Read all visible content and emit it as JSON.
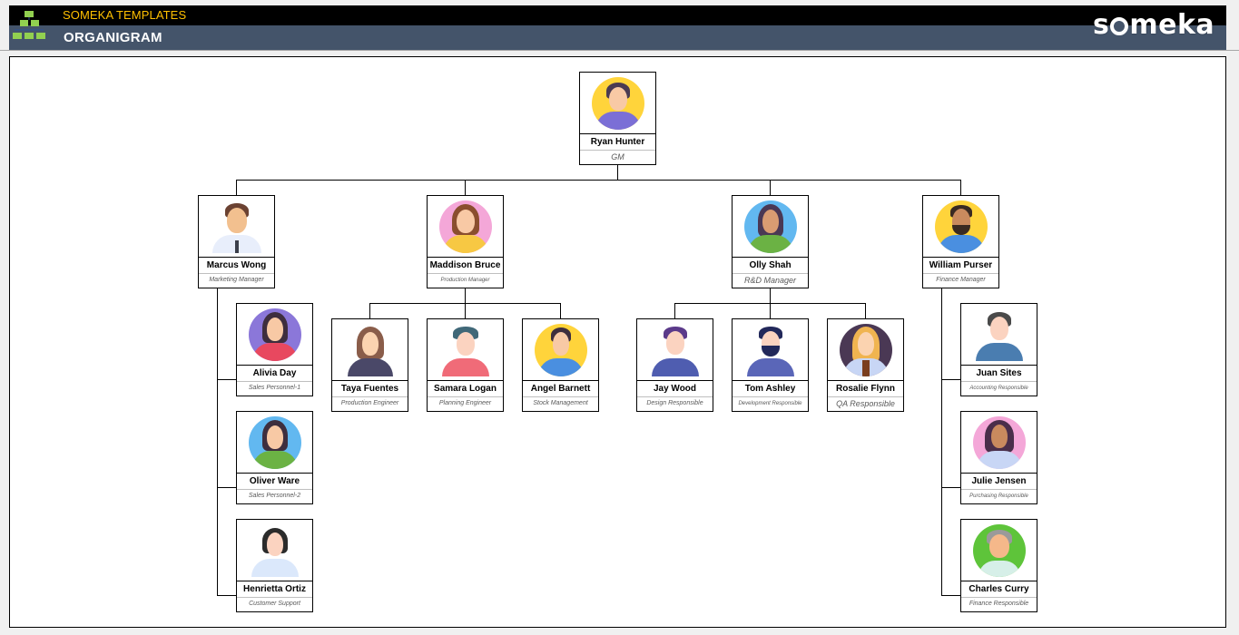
{
  "header": {
    "brand_top": "SOMEKA TEMPLATES",
    "title": "ORGANIGRAM",
    "logo_text": "someka",
    "colors": {
      "top_band": "#000000",
      "bottom_band": "#44546a",
      "brand_accent": "#ffc000"
    }
  },
  "org": {
    "root": {
      "name": "Ryan Hunter",
      "title": "GM",
      "avatar": "man-purple-shirt-yellow-bg"
    },
    "managers": [
      {
        "name": "Marcus Wong",
        "title": "Marketing Manager",
        "avatar": "man-tie-plain",
        "reports": [
          {
            "name": "Alivia Day",
            "title": "Sales Personnel-1",
            "avatar": "woman-red-hoodie-purple-bg"
          },
          {
            "name": "Oliver Ware",
            "title": "Sales Personnel-2",
            "avatar": "woman-green-sweater-blue-bg"
          },
          {
            "name": "Henrietta Ortiz",
            "title": "Customer Support",
            "avatar": "woman-nurse-plain"
          }
        ]
      },
      {
        "name": "Maddison Bruce",
        "title": "Production Manager",
        "avatar": "woman-yellow-jacket-pink-bg",
        "reports": [
          {
            "name": "Taya Fuentes",
            "title": "Production Engineer",
            "avatar": "woman-dark-blazer-plain"
          },
          {
            "name": "Samara Logan",
            "title": "Planning Engineer",
            "avatar": "man-red-shirt-plain"
          },
          {
            "name": "Angel Barnett",
            "title": "Stock Management",
            "avatar": "woman-ponytail-yellow-bg"
          }
        ]
      },
      {
        "name": "Olly Shah",
        "title": "R&D Manager",
        "avatar": "woman-green-hoodie-blue-bg",
        "reports": [
          {
            "name": "Jay Wood",
            "title": "Design Responsible",
            "avatar": "man-purple-hair-plain"
          },
          {
            "name": "Tom Ashley",
            "title": "Development Responsible",
            "avatar": "man-beard-glasses-plain"
          },
          {
            "name": "Rosalie Flynn",
            "title": "QA Responsible",
            "avatar": "woman-blonde-dark-bg"
          }
        ]
      },
      {
        "name": "William Purser",
        "title": "Finance Manager",
        "avatar": "man-beard-blue-jacket-yellow-bg",
        "reports": [
          {
            "name": "Juan Sites",
            "title": "Accounting Responsible",
            "avatar": "man-blue-shirt-plain"
          },
          {
            "name": "Julie Jensen",
            "title": "Purchasing Responsible",
            "avatar": "woman-purple-pink-bg"
          },
          {
            "name": "Charles Curry",
            "title": "Finance Responsible",
            "avatar": "old-man-glasses-green-bg"
          }
        ]
      }
    ]
  }
}
